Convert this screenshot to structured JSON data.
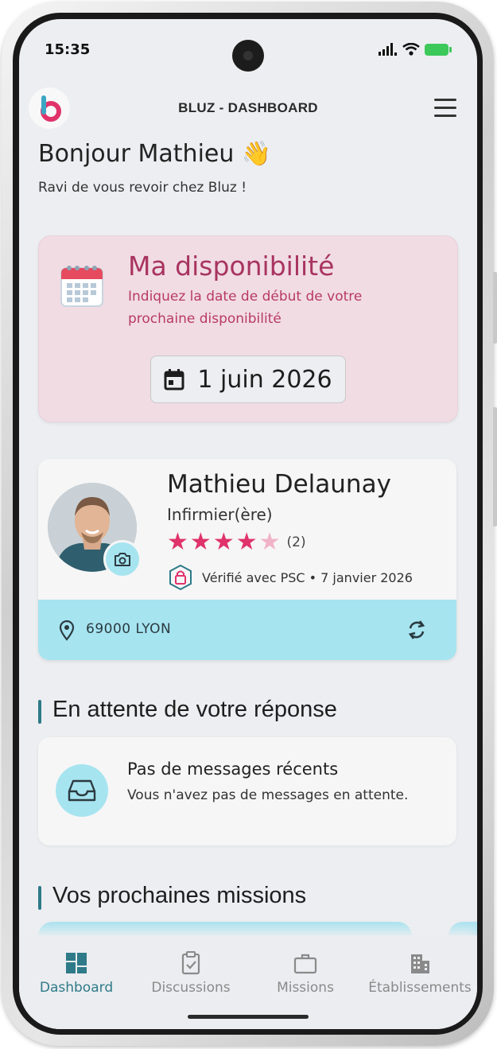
{
  "status_bar": {
    "time": "15:35"
  },
  "header": {
    "title": "BLUZ - DASHBOARD",
    "logo_letter": "b"
  },
  "greeting": {
    "title": "Bonjour Mathieu 👋",
    "subtitle": "Ravi de vous revoir chez Bluz !"
  },
  "availability": {
    "title": "Ma disponibilité",
    "description": "Indiquez la date de début de votre prochaine disponibilité",
    "date": "1 juin 2026"
  },
  "profile": {
    "name": "Mathieu Delaunay",
    "role": "Infirmier(ère)",
    "rating": 4,
    "rating_max": 5,
    "rating_count": "(2)",
    "verification": "Vérifié avec PSC • 7 janvier 2026",
    "location": "69000 LYON"
  },
  "pending": {
    "title": "En attente de votre réponse",
    "empty_title": "Pas de messages récents",
    "empty_text": "Vous n'avez pas de messages en attente."
  },
  "missions": {
    "title": "Vos prochaines missions"
  },
  "nav": {
    "items": [
      {
        "label": "Dashboard",
        "icon": "dashboard-icon"
      },
      {
        "label": "Discussions",
        "icon": "clipboard-check-icon"
      },
      {
        "label": "Missions",
        "icon": "briefcase-icon"
      },
      {
        "label": "Établissements",
        "icon": "building-icon"
      }
    ],
    "active": "Dashboard"
  },
  "colors": {
    "accent": "#2e7a88",
    "availability_bg": "#f1dce4",
    "availability_text": "#a8345f",
    "light_blue": "#a6e4f0",
    "star": "#e0336b",
    "star_empty": "#f0b3c8"
  }
}
